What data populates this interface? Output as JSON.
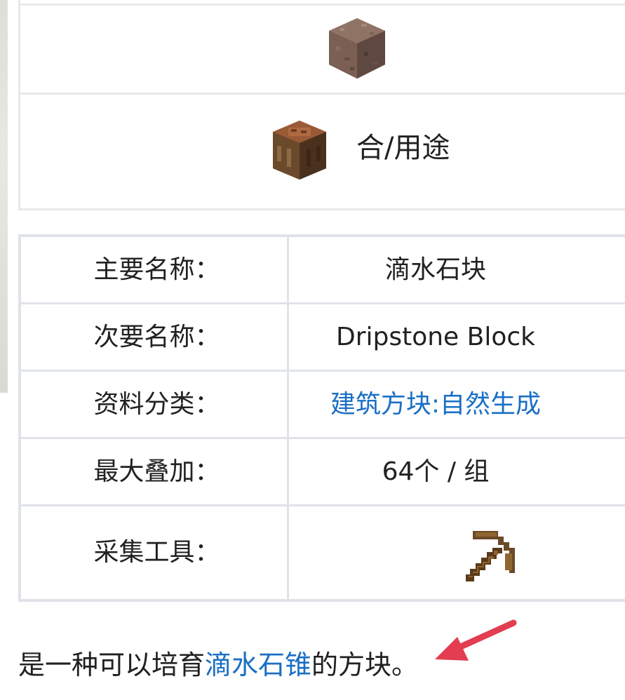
{
  "crafting": {
    "label": "合/用途"
  },
  "info": {
    "rows": [
      {
        "key": "主要名称：",
        "value": "滴水石块"
      },
      {
        "key": "次要名称：",
        "value": "Dripstone Block"
      },
      {
        "key": "资料分类：",
        "value": "建筑方块:自然生成"
      },
      {
        "key": "最大叠加：",
        "value": "64个 / 组"
      },
      {
        "key": "采集工具：",
        "value": ""
      }
    ]
  },
  "description": {
    "prefix": "是一种可以培育",
    "link": "滴水石锥",
    "suffix": "的方块。"
  },
  "colors": {
    "link": "#1a6fc4",
    "border": "#dfe3e8",
    "arrow": "#e23d50"
  },
  "icons": {
    "block": "dripstone-block-icon",
    "crafting": "crafting-table-icon",
    "tool": "wooden-pickaxe-icon",
    "annotation": "red-arrow-icon"
  }
}
